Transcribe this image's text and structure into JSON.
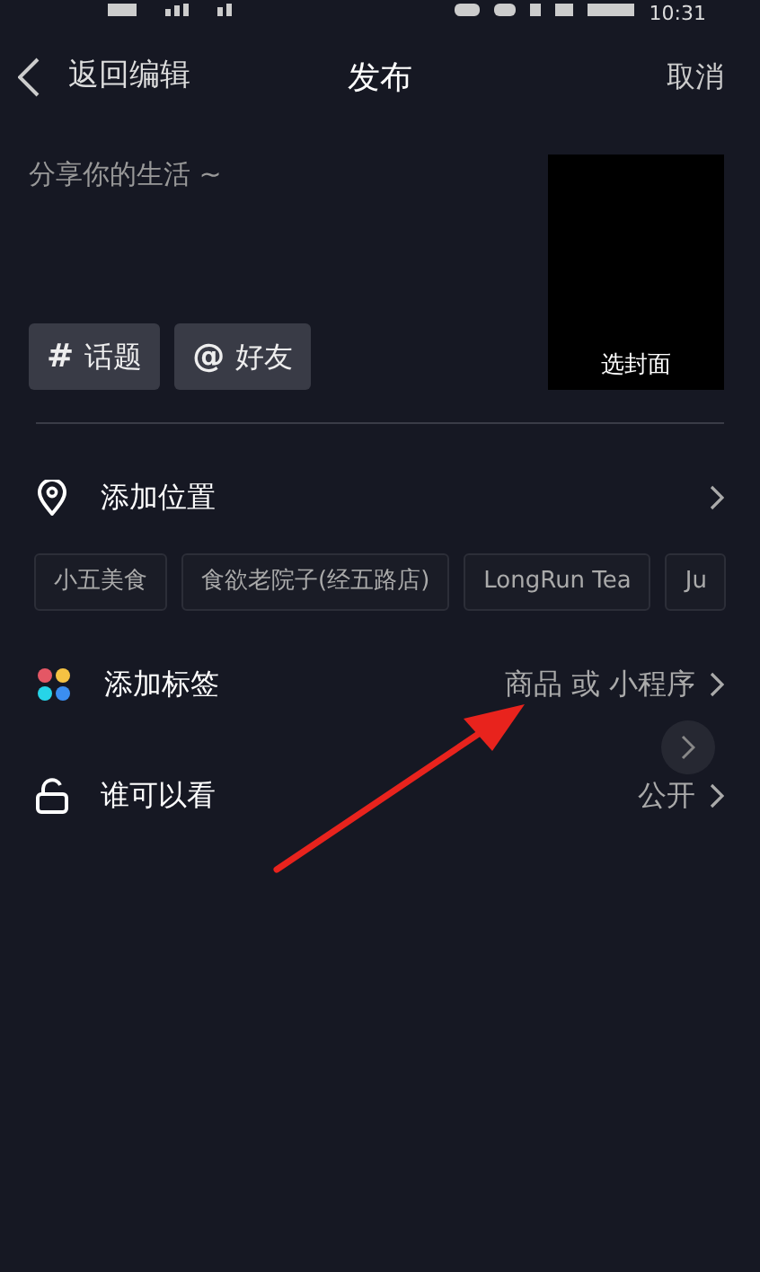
{
  "status_bar": {
    "time": "10:31"
  },
  "header": {
    "back": "返回编辑",
    "title": "发布",
    "cancel": "取消"
  },
  "caption": {
    "placeholder": "分享你的生活 ~"
  },
  "cover": {
    "label": "选封面"
  },
  "quick_tags": [
    {
      "symbol": "#",
      "label": "话题"
    },
    {
      "symbol": "@",
      "label": "好友"
    }
  ],
  "rows": [
    {
      "kind": "location",
      "label": "添加位置"
    },
    {
      "kind": "tags",
      "label": "添加标签",
      "value": "商品 或 小程序"
    },
    {
      "kind": "privacy",
      "label": "谁可以看",
      "value": "公开"
    }
  ],
  "location_suggestions": [
    "小五美食",
    "食欲老院子(经五路店)",
    "LongRun Tea",
    "Ju"
  ]
}
